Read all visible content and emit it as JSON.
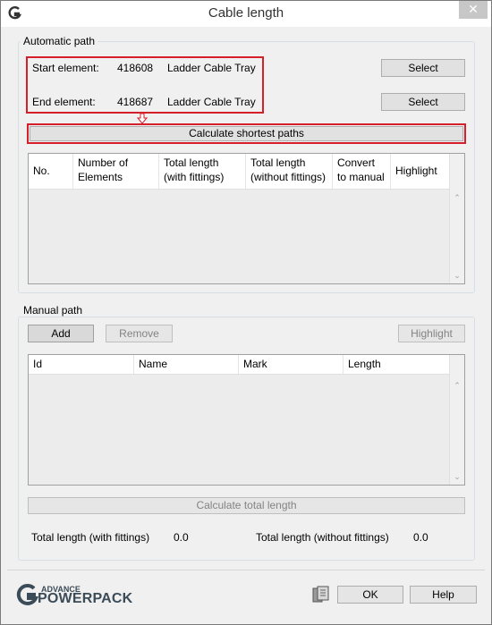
{
  "window": {
    "title": "Cable length",
    "close_icon": "✕"
  },
  "auto_path": {
    "group_label": "Automatic path",
    "start": {
      "label": "Start element:",
      "id": "418608",
      "type": "Ladder Cable Tray",
      "button": "Select"
    },
    "end": {
      "label": "End element:",
      "id": "418687",
      "type": "Ladder Cable Tray",
      "button": "Select"
    },
    "calculate_button": "Calculate shortest paths",
    "columns": [
      {
        "line1": "No.",
        "line2": ""
      },
      {
        "line1": "Number of",
        "line2": "Elements"
      },
      {
        "line1": "Total length",
        "line2": "(with fittings)"
      },
      {
        "line1": "Total length",
        "line2": "(without fittings)"
      },
      {
        "line1": "Convert",
        "line2": "to manual"
      },
      {
        "line1": "Highlight",
        "line2": ""
      }
    ]
  },
  "manual_path": {
    "group_label": "Manual path",
    "add_button": "Add",
    "remove_button": "Remove",
    "highlight_button": "Highlight",
    "columns": [
      "Id",
      "Name",
      "Mark",
      "Length"
    ],
    "calculate_total_button": "Calculate total length",
    "total_with_label": "Total length (with fittings)",
    "total_with_value": "0.0",
    "total_without_label": "Total length (without fittings)",
    "total_without_value": "0.0"
  },
  "footer": {
    "brand_small": "ADVANCE",
    "brand_large": "POWERPACK",
    "ok_button": "OK",
    "help_button": "Help"
  },
  "colors": {
    "highlight_box": "#d4202a",
    "brand": "#3b4b57"
  }
}
